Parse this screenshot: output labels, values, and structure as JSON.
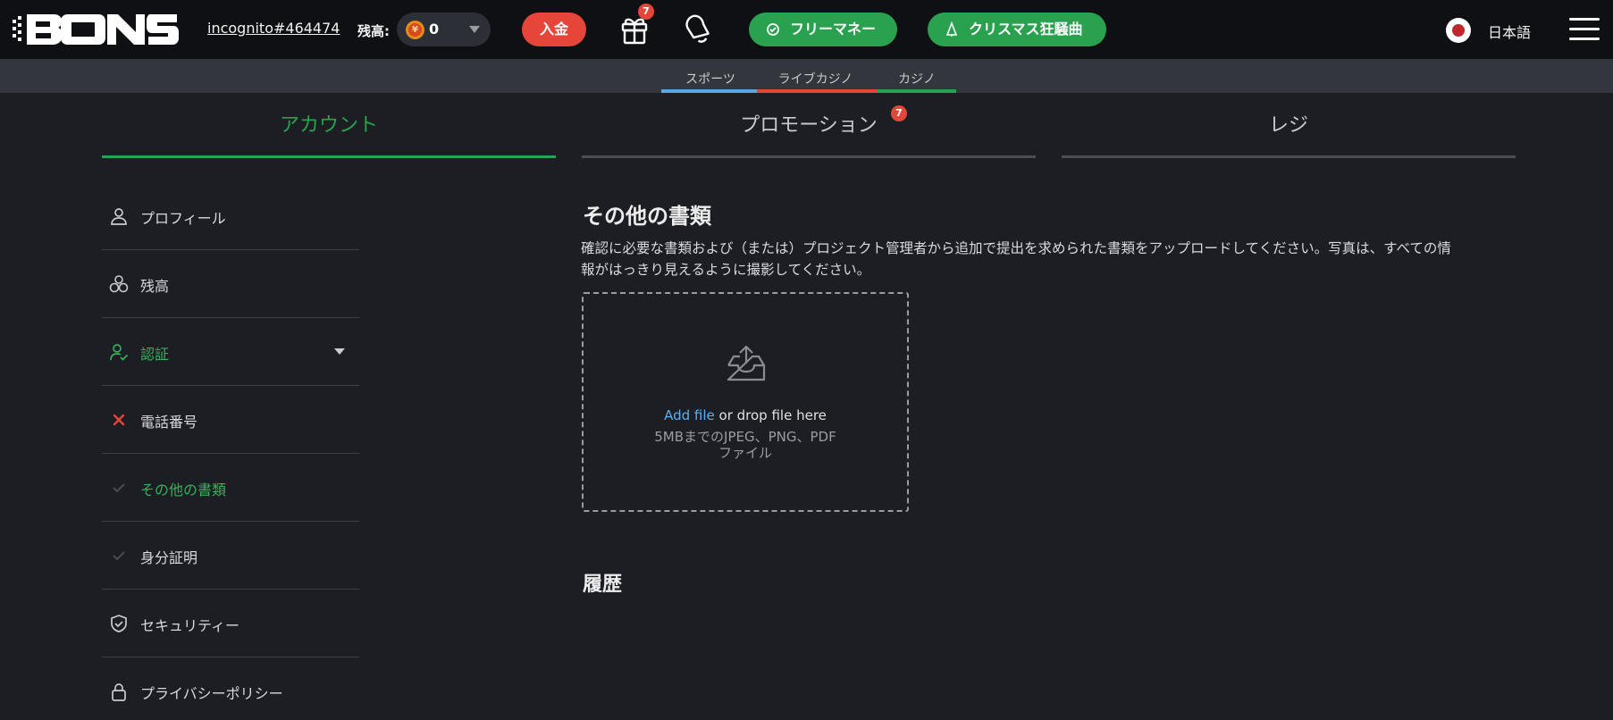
{
  "header": {
    "logo_text": "BONS",
    "username": "incognito#464474",
    "balance_label": "残高:",
    "balance_value": "0",
    "currency_symbol": "¥",
    "deposit_label": "入金",
    "gift_badge": "7",
    "free_money_label": "フリーマネー",
    "christmas_label": "クリスマス狂騒曲",
    "language": "日本語"
  },
  "product_nav": [
    {
      "label": "スポーツ",
      "color": "#5aa7e0"
    },
    {
      "label": "ライブカジノ",
      "color": "#e6453a"
    },
    {
      "label": "カジノ",
      "color": "#2aa14f"
    }
  ],
  "tabs": [
    {
      "label": "アカウント",
      "active": true
    },
    {
      "label": "プロモーション",
      "badge": "7"
    },
    {
      "label": "レジ"
    }
  ],
  "sidebar": {
    "items": [
      {
        "label": "プロフィール",
        "icon": "user-icon"
      },
      {
        "label": "残高",
        "icon": "coins-icon"
      },
      {
        "label": "認証",
        "icon": "user-check-icon",
        "expanded": true
      },
      {
        "label": "電話番号",
        "icon": "cross-icon",
        "status": "unverified"
      },
      {
        "label": "その他の書類",
        "icon": "check-icon",
        "active": true
      },
      {
        "label": "身分証明",
        "icon": "check-icon"
      },
      {
        "label": "セキュリティー",
        "icon": "shield-icon"
      },
      {
        "label": "プライバシーポリシー",
        "icon": "lock-icon"
      }
    ]
  },
  "main": {
    "title": "その他の書類",
    "description_line1": "確認に必要な書類および（または）プロジェクト管理者から追加で提出を求められた書類をアップロードしてください。写真は、すべての情",
    "description_line2": "報がはっきり見えるように撮影してください。",
    "dropzone": {
      "add_file": "Add file",
      "or_drop": " or drop file here",
      "limits_line1": "5MBまでのJPEG、PNG、PDF",
      "limits_line2": "ファイル"
    },
    "history_title": "履歴"
  },
  "colors": {
    "accent_green": "#2aa14f",
    "accent_red": "#e6453a",
    "link_blue": "#5eb0f0",
    "background": "#1c1e23",
    "header_bg": "#0e1013"
  }
}
